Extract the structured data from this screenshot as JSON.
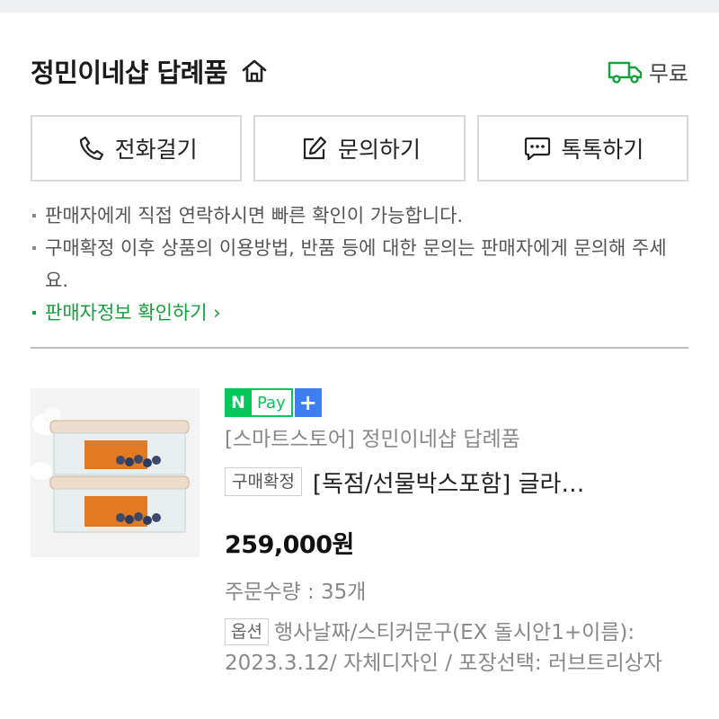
{
  "store": {
    "name": "정민이네샵 답례품",
    "home_icon": "home-icon",
    "shipping_icon": "truck-icon",
    "shipping_label": "무료"
  },
  "contact_buttons": [
    {
      "icon": "phone-icon",
      "label": "전화걸기"
    },
    {
      "icon": "pencil-square-icon",
      "label": "문의하기"
    },
    {
      "icon": "chat-bubble-icon",
      "label": "톡톡하기"
    }
  ],
  "notes": [
    "판매자에게 직접 연락하시면 빠른 확인이 가능합니다.",
    "구매확정 이후 상품의 이용방법, 반품 등에 대한 문의는 판매자에게 문의해 주세요."
  ],
  "seller_info_link": "판매자정보 확인하기",
  "product": {
    "npay_n": "N",
    "npay_pay": "Pay",
    "npay_plus": "+",
    "store_line": "[스마트스토어] 정민이네샵 답례품",
    "status_badge": "구매확정",
    "title": "[독점/선물박스포함] 글라…",
    "price": "259,000원",
    "quantity": "주문수량 : 35개",
    "option_badge": "옵션",
    "option_text": "행사날짜/스티커문구(EX 돌시안1+이름): 2023.3.12/ 자체디자인 / 포장선택: 러브트리상자"
  },
  "colors": {
    "accent_green": "#15a13b",
    "npay_green": "#03c75a",
    "plus_blue": "#3d7ff0"
  }
}
